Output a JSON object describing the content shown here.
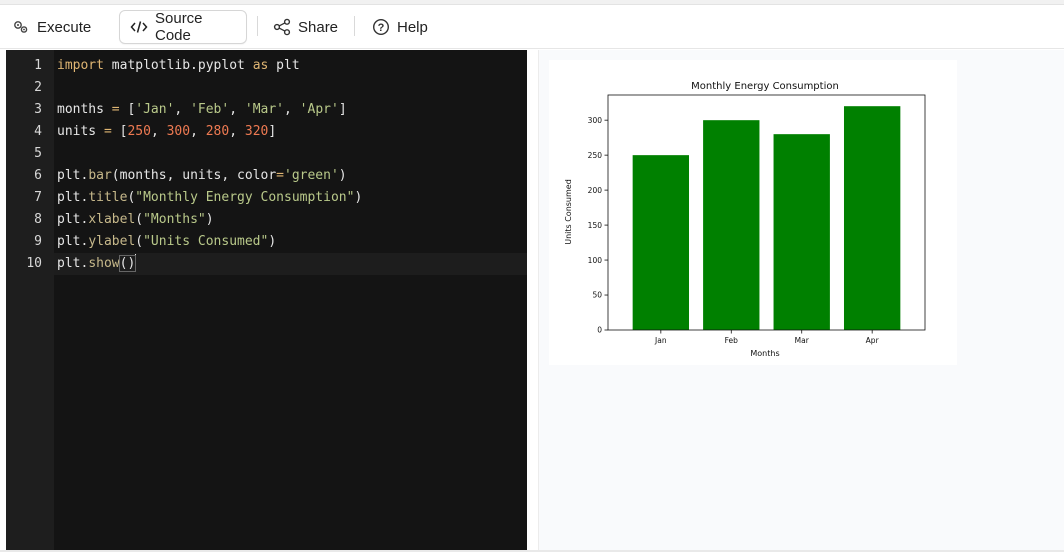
{
  "toolbar": {
    "execute_label": "Execute",
    "source_label": "Source Code",
    "share_label": "Share",
    "help_label": "Help",
    "icons": [
      "gears-icon",
      "code-icon",
      "share-icon",
      "help-icon"
    ]
  },
  "editor": {
    "line_numbers": [
      "1",
      "2",
      "3",
      "4",
      "5",
      "6",
      "7",
      "8",
      "9",
      "10"
    ],
    "active_line": "10"
  },
  "chart_data": {
    "type": "bar",
    "title": "Monthly Energy Consumption",
    "xlabel": "Months",
    "ylabel": "Units Consumed",
    "categories": [
      "Jan",
      "Feb",
      "Mar",
      "Apr"
    ],
    "values": [
      250,
      300,
      280,
      320
    ],
    "ylim": [
      0,
      336
    ],
    "yticks": [
      0,
      50,
      100,
      150,
      200,
      250,
      300
    ],
    "color": "#008000",
    "grid": false
  }
}
